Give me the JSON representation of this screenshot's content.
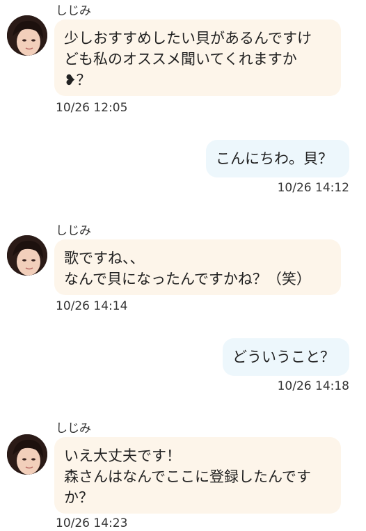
{
  "colors": {
    "incoming_bubble": "#fdf5ea",
    "outgoing_bubble": "#edf7fc",
    "text": "#222222"
  },
  "messages": [
    {
      "direction": "incoming",
      "sender": "しじみ",
      "lines": [
        "少しおすすめしたい貝があるんですけ",
        "ども私のオススメ聞いてくれますか",
        "❥？"
      ],
      "time": "10/26 12:05"
    },
    {
      "direction": "outgoing",
      "lines": [
        "こんにちわ。貝？"
      ],
      "time": "10/26 14:12"
    },
    {
      "direction": "incoming",
      "sender": "しじみ",
      "lines": [
        "歌ですね、、",
        "なんで貝になったんですかね？（笑）"
      ],
      "time": "10/26 14:14"
    },
    {
      "direction": "outgoing",
      "lines": [
        "どういうこと？"
      ],
      "time": "10/26 14:18"
    },
    {
      "direction": "incoming",
      "sender": "しじみ",
      "lines": [
        "いえ大丈夫です！",
        "森さんはなんでここに登録したんです",
        "か？"
      ],
      "time": "10/26 14:23"
    }
  ]
}
